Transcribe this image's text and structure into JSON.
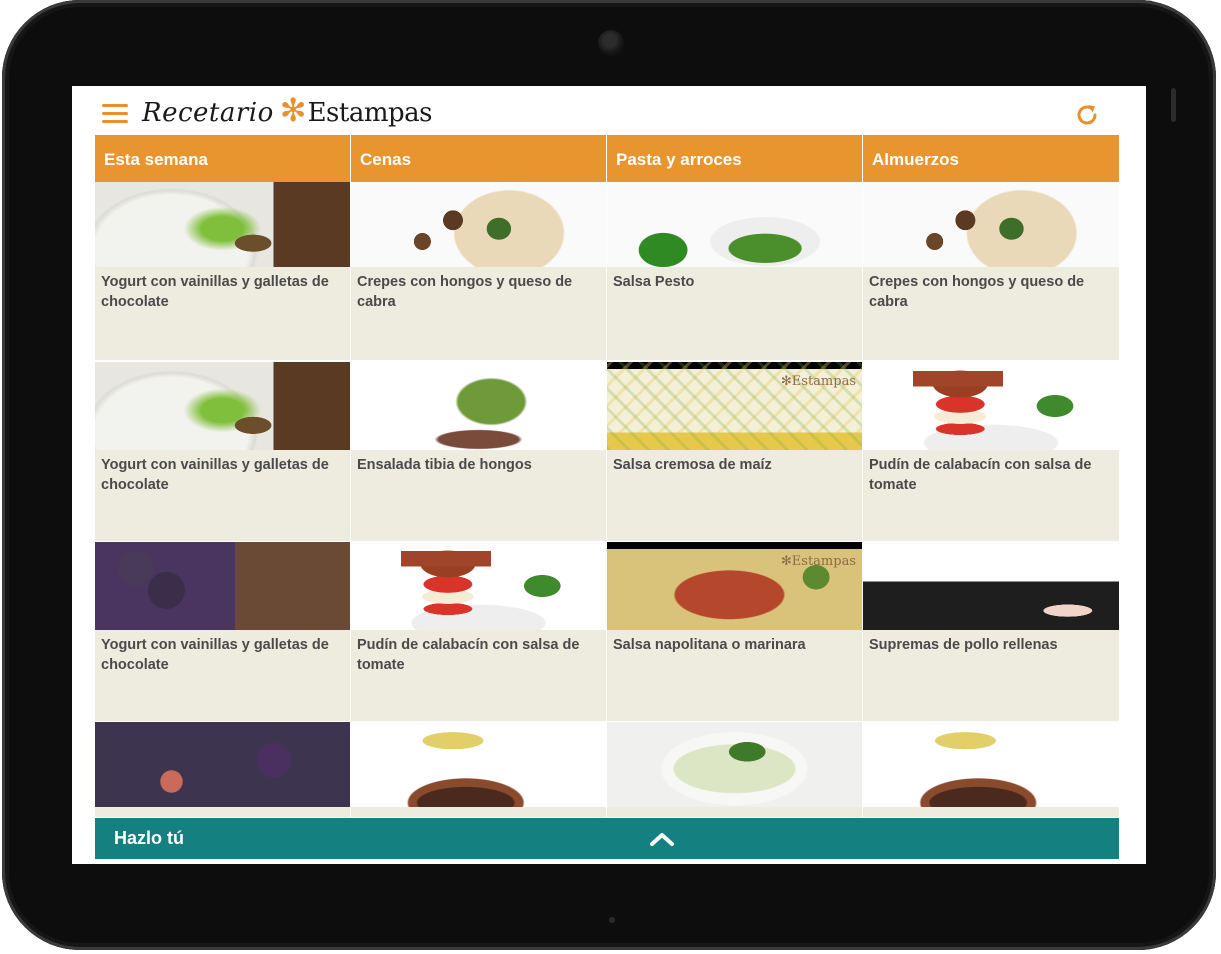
{
  "app": {
    "title_script": "Recetario",
    "title_brand": "Estampas",
    "accent_color": "#e8952f",
    "teal_color": "#148080"
  },
  "header": {
    "menu_icon": "hamburger-menu-icon",
    "refresh_icon": "refresh-icon"
  },
  "columns": [
    {
      "title": "Esta semana",
      "cards": [
        {
          "title": "Yogurt con vainillas y galletas de chocolate",
          "image": "yogurt"
        },
        {
          "title": "Yogurt con vainillas y galletas de chocolate",
          "image": "yogurt"
        },
        {
          "title": "Yogurt con vainillas y galletas de chocolate",
          "image": "higos"
        },
        {
          "title": "",
          "image": "higos2"
        }
      ]
    },
    {
      "title": "Cenas",
      "cards": [
        {
          "title": "Crepes con hongos y queso de cabra",
          "image": "crepes"
        },
        {
          "title": "Ensalada tibia de hongos",
          "image": "ensalada"
        },
        {
          "title": "Pudín  de calabacín con salsa de tomate",
          "image": "pudin"
        },
        {
          "title": "",
          "image": "cazuela"
        }
      ]
    },
    {
      "title": "Pasta y arroces",
      "cards": [
        {
          "title": "Salsa Pesto",
          "image": "pesto"
        },
        {
          "title": "Salsa cremosa de maíz",
          "image": "maiz"
        },
        {
          "title": "Salsa napolitana o marinara",
          "image": "napolitana"
        },
        {
          "title": "",
          "image": "arroz"
        }
      ]
    },
    {
      "title": "Almuerzos",
      "cards": [
        {
          "title": "Crepes con hongos y queso de cabra",
          "image": "crepes"
        },
        {
          "title": "Pudín de calabacín con salsa de tomate",
          "image": "pudin"
        },
        {
          "title": "Supremas de pollo rellenas",
          "image": "supremas"
        },
        {
          "title": "",
          "image": "cazuela"
        }
      ]
    }
  ],
  "bottom_bar": {
    "label": "Hazlo tú",
    "icon": "chevron-up-icon"
  }
}
